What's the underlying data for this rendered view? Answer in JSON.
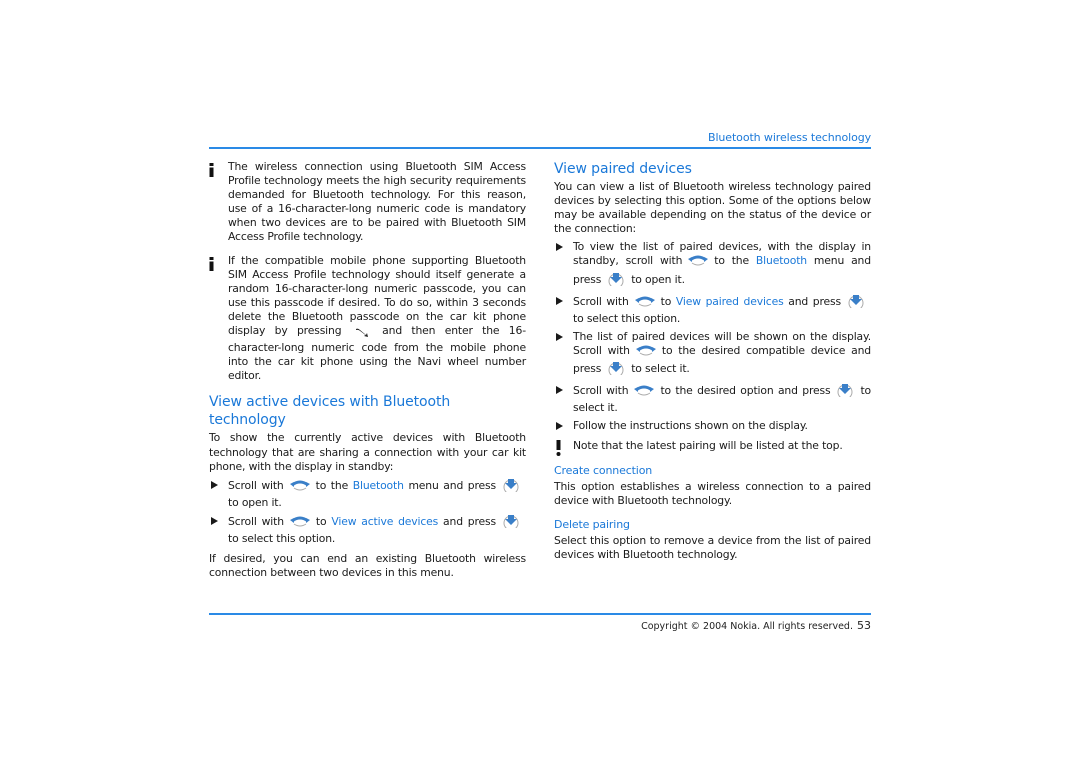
{
  "header": {
    "running_head": "Bluetooth wireless technology"
  },
  "footer": {
    "copyright": "Copyright © 2004 Nokia. All rights reserved.",
    "page_number": "53"
  },
  "left_column": {
    "notes": [
      {
        "icon": "info-icon",
        "text": "The wireless connection using Bluetooth SIM Access Profile technology meets the high security requirements demanded for Bluetooth technology. For this reason, use of a 16-character-long numeric code is mandatory when two devices are to be paired with Bluetooth SIM Access Profile technology."
      },
      {
        "icon": "info-icon",
        "text_before": "If the compatible mobile phone supporting Bluetooth SIM Access Profile technology should itself generate a random 16-character-long numeric passcode, you can use this passcode if desired. To do so, within 3 seconds delete the Bluetooth passcode on the car kit phone display by pressing",
        "key_icon": "end-call-key-icon",
        "text_after": "and then enter the 16-character-long numeric code from the mobile phone into the car kit phone using the Navi wheel number editor."
      }
    ],
    "section": {
      "heading": "View active devices with Bluetooth technology",
      "intro": "To show the currently active devices with Bluetooth technology that are sharing a connection with your car kit phone, with the display in standby:",
      "steps": [
        {
          "a": "Scroll with",
          "b": "to the",
          "link": "Bluetooth",
          "c": "menu and press",
          "d": "to open it."
        },
        {
          "a": "Scroll with",
          "b": "to",
          "link": "View active devices",
          "c": "and press",
          "d": "to select this option."
        }
      ],
      "outro": "If desired, you can end an existing Bluetooth wireless connection between two devices in this menu."
    }
  },
  "right_column": {
    "heading": "View paired devices",
    "intro": "You can view a list of Bluetooth wireless technology paired devices by selecting this option. Some of the options below may be available depending on the status of the device or the connection:",
    "steps": [
      {
        "a": "To view the list of paired devices, with the display in standby, scroll with",
        "b": "to the",
        "link": "Bluetooth",
        "c": "menu and press",
        "d": "to open it."
      },
      {
        "a": "Scroll with",
        "b": "to",
        "link": "View paired devices",
        "c": "and press",
        "d": "to select this option."
      },
      {
        "a": "The list of paired devices will be shown on the display. Scroll with",
        "b": "to the desired compatible device and press",
        "d": "to select it."
      },
      {
        "a": "Scroll with",
        "b": "to the desired option and press",
        "d": "to select it."
      },
      {
        "a": "Follow the instructions shown on the display."
      }
    ],
    "warning": {
      "icon": "exclamation-icon",
      "text": "Note that the latest pairing will be listed at the top."
    },
    "subsections": [
      {
        "heading": "Create connection",
        "text": "This option establishes a wireless connection to a paired device with Bluetooth technology."
      },
      {
        "heading": "Delete pairing",
        "text": "Select this option to remove a device from the list of paired devices with Bluetooth technology."
      }
    ]
  },
  "icons": {
    "scroll": "navi-wheel-scroll-icon",
    "press": "navi-wheel-press-icon",
    "accent_color": "#1a78d8"
  }
}
